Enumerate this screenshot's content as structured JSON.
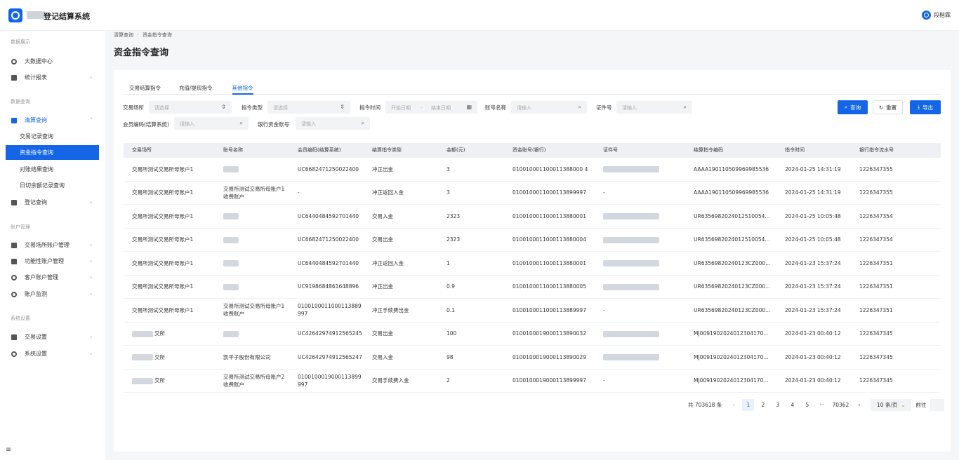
{
  "header": {
    "app_title": "登记结算系统",
    "user_name": "段楷霖"
  },
  "sidebar": {
    "groups": [
      "数据展示",
      "数据查询",
      "账户管理",
      "系统设置"
    ],
    "items": [
      {
        "label": "大数据中心",
        "icon": "dashboard-icon"
      },
      {
        "label": "统计报表",
        "icon": "report-icon"
      },
      {
        "label": "清算查询",
        "icon": "clearing-icon"
      },
      {
        "label": "交易记录查询"
      },
      {
        "label": "资金指令查询"
      },
      {
        "label": "对账结果查询"
      },
      {
        "label": "日切余额记录查询"
      },
      {
        "label": "登记查询",
        "icon": "register-icon"
      },
      {
        "label": "交易场所账户管理",
        "icon": "wallet-icon"
      },
      {
        "label": "功能性账户管理",
        "icon": "lock-icon"
      },
      {
        "label": "客户账户管理",
        "icon": "user-icon"
      },
      {
        "label": "账户监测",
        "icon": "monitor-icon"
      },
      {
        "label": "交易设置",
        "icon": "trade-settings-icon"
      },
      {
        "label": "系统设置",
        "icon": "gear-icon"
      }
    ]
  },
  "breadcrumb": {
    "parent": "清算查询",
    "current": "资金指令查询"
  },
  "page_title": "资金指令查询",
  "tabs": [
    "交易结算指令",
    "充值/提现指令",
    "其他指令"
  ],
  "filters": {
    "venue_label": "交易场所",
    "venue_placeholder": "请选择",
    "type_label": "指令类型",
    "type_placeholder": "请选择",
    "time_label": "指令时间",
    "start_placeholder": "开始日期",
    "range_sep": "-",
    "end_placeholder": "结束日期",
    "acct_name_label": "账号名称",
    "acct_name_placeholder": "请输入",
    "cert_label": "证件号",
    "cert_placeholder": "请输入",
    "member_label": "会员编码(结算系统)",
    "member_placeholder": "请输入",
    "bank_label": "银行资金账号",
    "bank_placeholder": "请输入"
  },
  "buttons": {
    "search": "查询",
    "reset": "重置",
    "export": "导出"
  },
  "table": {
    "headers": [
      "交易场所",
      "账号名称",
      "会员编码(结算系统)",
      "结算指令类型",
      "金额(元)",
      "资金账号(银行)",
      "证件号",
      "结算指令编码",
      "指令时间",
      "银行指令流水号"
    ],
    "rows": [
      [
        "交易所测试交易所母账户1",
        "",
        "UC6682471250022400",
        "冲正出金",
        "3",
        "010010001100011388000 4",
        "",
        "AAAA190110509969985536",
        "2024-01-25 14:31:19",
        "1226347355"
      ],
      [
        "交易所测试交易所母账户1",
        "交易所测试交易所母账户1收费账户",
        "-",
        "冲正返回入金",
        "3",
        "0100100011000113899997",
        "-",
        "AAAA190110509969985536",
        "2024-01-25 14:31:19",
        "1226347355"
      ],
      [
        "交易所测试交易所母账户1",
        "",
        "UC6440484592701440",
        "交易入金",
        "2323",
        "0100100011000113880001",
        "",
        "UR635698202401251005​4...",
        "2024-01-25 10:05:48",
        "1226347354"
      ],
      [
        "交易所测试交易所母账户1",
        "",
        "UC6682471250022400",
        "交易出金",
        "2323",
        "0100100011000113880004",
        "",
        "UR635698202401251005​4...",
        "2024-01-25 10:05:48",
        "1226347354"
      ],
      [
        "交易所测试交易所母账户1",
        "",
        "UC6440484592701440",
        "冲正返回入金",
        "1",
        "0100100011000113880001",
        "",
        "UR635698202401​23CZ000...",
        "2024-01-23 15:37:24",
        "1226347351"
      ],
      [
        "交易所测试交易所母账户1",
        "",
        "UC9198684861648896",
        "冲正出金",
        "0.9",
        "0100100011000113880005",
        "",
        "UR635698202401​23CZ000...",
        "2024-01-23 15:37:24",
        "1226347351"
      ],
      [
        "交易所测试交易所母账户1",
        "交易所测试交易所母账户1收费账户",
        "0100100011000113889997",
        "冲正手续费出金",
        "0.1",
        "0100100011000113889997",
        "-",
        "UR635698202401​23CZ000...",
        "2024-01-23 15:37:24",
        "1226347351"
      ],
      [
        "交所",
        "",
        "UC42642974912565245",
        "交易出金",
        "100",
        "0100100019000113890032",
        "",
        "MJ009190202401230417​0...",
        "2024-01-23 00:40:12",
        "1226347345"
      ],
      [
        "交所",
        "凯平子股份有限公司",
        "UC42642974912565247",
        "交易入金",
        "98",
        "0100100019000113890029",
        "",
        "MJ009190202401230417​0...",
        "2024-01-23 00:40:12",
        "1226347345"
      ],
      [
        "交所",
        "交易所测试交易所母账户2收费账户",
        "0100100019000113899997",
        "交易手续费入金",
        "2",
        "0100100019000113899997",
        "-",
        "MJ009190202401230417​0...",
        "2024-01-23 00:40:12",
        "1226347345"
      ]
    ]
  },
  "pagination": {
    "total_text": "共 703618 条",
    "pages": [
      "1",
      "2",
      "3",
      "4",
      "5",
      "···",
      "70362"
    ],
    "active_page": "1",
    "page_size": "10 条/页",
    "jump_label": "前往"
  }
}
